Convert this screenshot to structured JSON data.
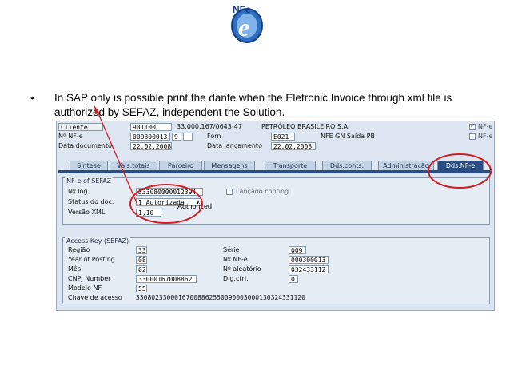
{
  "logo": {
    "text": "NFe",
    "letter": "e"
  },
  "bullet": {
    "symbol": "•",
    "text": "In SAP  only is possible print the danfe when the Eletronic Invoice through xml file is authorized by SEFAZ, independent  the Solution."
  },
  "header": {
    "cliente_label": "Cliente",
    "cliente_value": "901100",
    "cnpj": "33.000.167/0643-47",
    "company": "PETRÓLEO BRASILEIRO S.A.",
    "nfe_label": "Nº NF-e",
    "nfe_value": "000300013",
    "nfe_series": "9",
    "forn_label": "Forn",
    "forn_value": "E021",
    "forn_desc": "NFE GN Saída PB",
    "doc_date_label": "Data documento",
    "doc_date_value": "22.02.2008",
    "launch_label": "Data lançamento",
    "launch_value": "22.02.2008",
    "flag1": "NF-e",
    "flag2": "NF-e"
  },
  "tabs": [
    "Síntese",
    "Vals.totais",
    "Parceiro",
    "Mensagens",
    "Transporte",
    "Dds.conts.",
    "Administração",
    "Dds.NF-e"
  ],
  "active_tab": "Dds.NF-e",
  "sefaz_group": {
    "title": "NF-e of SEFAZ",
    "log_label": "Nº log",
    "log_value": "333080000012394",
    "contingency_label": "Lançado conting",
    "status_label": "Status do doc.",
    "status_value": "1 Autorizada",
    "version_label": "Versão XML",
    "version_value": "1,10"
  },
  "annotation": "Authorized",
  "access_group": {
    "title": "Access Key (SEFAZ)",
    "regiao_label": "Região",
    "regiao_value": "33",
    "year_label": "Year of Posting",
    "year_value": "08",
    "mes_label": "Mês",
    "mes_value": "02",
    "cnpj_label": "CNPJ Number",
    "cnpj_value": "33000167008862",
    "modelo_label": "Modelo NF",
    "modelo_value": "55",
    "chave_label": "Chave de acesso",
    "chave_value": "33080233000167008862550090003000130324331120",
    "serie_label": "Série",
    "serie_value": "009",
    "nfe_label": "Nº NF-e",
    "nfe_value": "000300013",
    "random_label": "Nº aleatório",
    "random_value": "032433112",
    "dig_label": "Díg.ctrl.",
    "dig_value": "0"
  },
  "colors": {
    "highlight": "#d01e26",
    "tab_active": "#2a4d83",
    "panel": "#dde6f0"
  }
}
